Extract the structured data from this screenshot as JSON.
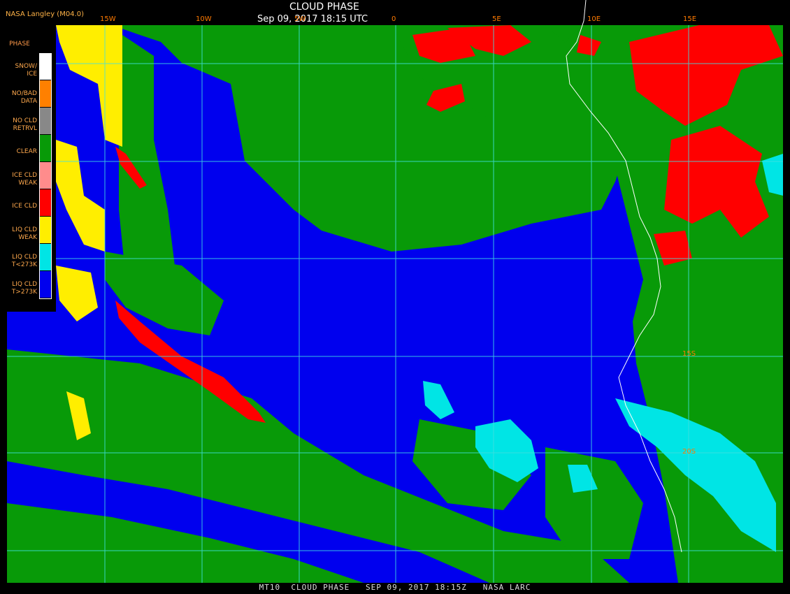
{
  "header": {
    "credit": "NASA Langley (M04.0)",
    "title": "CLOUD PHASE",
    "datetime": "Sep 09, 2017 18:15 UTC"
  },
  "footer": {
    "text": "MT10  CLOUD PHASE   SEP 09, 2017 18:15Z   NASA LARC"
  },
  "legend": {
    "title": "PHASE",
    "items": [
      {
        "label": "SNOW/\nICE",
        "color": "#ffffff"
      },
      {
        "label": "NO/BAD\nDATA",
        "color": "#ff8000"
      },
      {
        "label": "NO CLD\nRETRVL",
        "color": "#888888"
      },
      {
        "label": "CLEAR",
        "color": "#089a08"
      },
      {
        "label": "ICE CLD\nWEAK",
        "color": "#ff8c8c"
      },
      {
        "label": "ICE CLD",
        "color": "#ff0000"
      },
      {
        "label": "LIQ CLD\nWEAK",
        "color": "#ffee00"
      },
      {
        "label": "LIQ CLD\nT<273K",
        "color": "#00e5e5"
      },
      {
        "label": "LIQ CLD\nT>273K",
        "color": "#0000ee"
      }
    ]
  },
  "graticule": {
    "longitudes": [
      "15W",
      "10W",
      "5W",
      "0",
      "5E",
      "10E",
      "15E"
    ],
    "latitudes": [
      "15S",
      "20S"
    ]
  },
  "colors": {
    "ocean_liquid_warm": "#0000ee",
    "clear": "#089a08",
    "ice": "#ff0000",
    "liquid_cold": "#00e5e5",
    "liquid_weak": "#ffee00",
    "grid": "#40e0e0",
    "coast": "#ffffff"
  }
}
